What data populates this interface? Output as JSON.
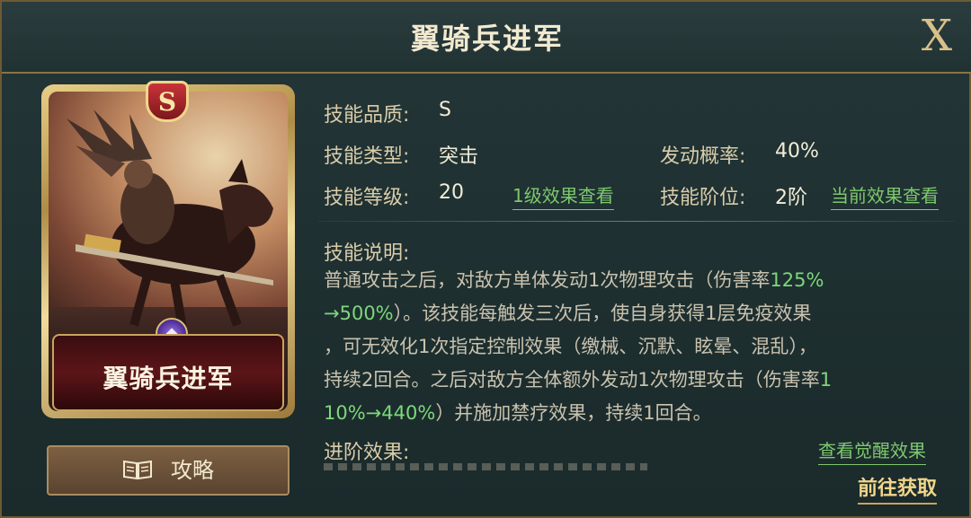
{
  "header": {
    "title": "翼骑兵进军",
    "close_label": "X"
  },
  "card": {
    "rank": "S",
    "name": "翼骑兵进军"
  },
  "guide_button": {
    "label": "攻略",
    "icon": "book-icon"
  },
  "info": {
    "quality_label": "技能品质:",
    "quality_value": "S",
    "type_label": "技能类型:",
    "type_value": "突击",
    "chance_label": "发动概率:",
    "chance_value": "40%",
    "level_label": "技能等级:",
    "level_value": "20",
    "level1_link": "1级效果查看",
    "rank_label": "技能阶位:",
    "rank_value": "2阶",
    "current_link": "当前效果查看"
  },
  "description": {
    "label": "技能说明:",
    "p1": "普通攻击之后，对敌方单体发动1次物理攻击（伤害率",
    "p1_green": "125%",
    "p2_green": "→500%",
    "p2": "）。该技能每触发三次后，使自身获得1层免疫效果",
    "p3": "，可无效化1次指定控制效果（缴械、沉默、眩晕、混乱），",
    "p4": "持续2回合。之后对敌方全体额外发动1次物理攻击（伤害率",
    "p4_green": "1",
    "p5_green": "10%→440%",
    "p5": "）并施加禁疗效果，持续1回合。"
  },
  "advance": {
    "label": "进阶效果:",
    "awaken_link": "查看觉醒效果"
  },
  "go_button": "前往获取"
}
